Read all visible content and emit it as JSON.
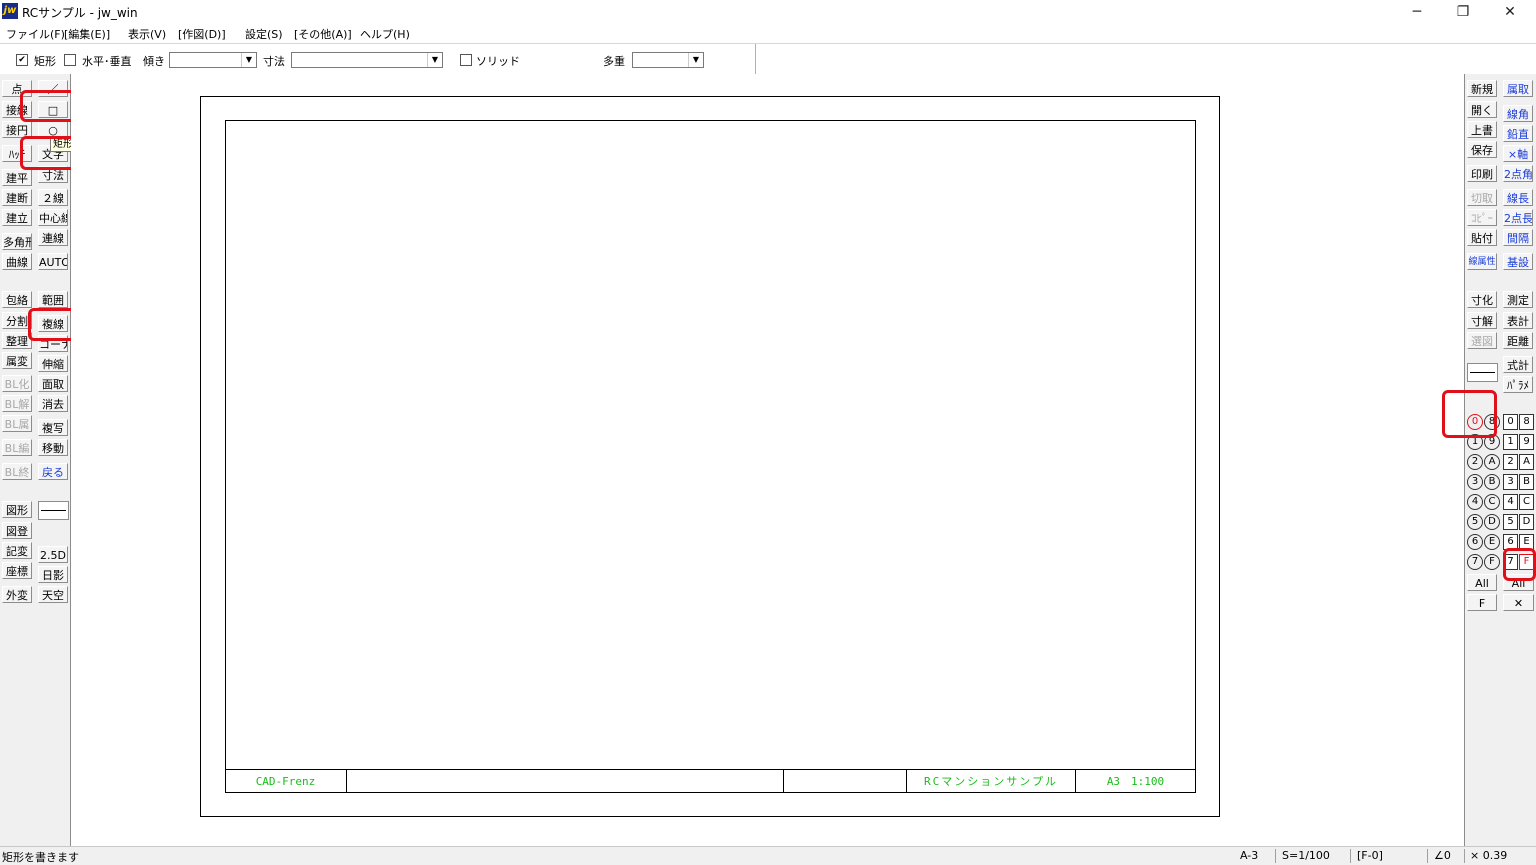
{
  "window": {
    "title": "RCサンプル - jw_win",
    "icon_text": "jw",
    "minimize": "─",
    "restore": "❐",
    "close": "✕"
  },
  "menu": [
    "ファイル(F)",
    "[編集(E)]",
    "表示(V)",
    "[作図(D)]",
    "設定(S)",
    "[その他(A)]",
    "ヘルプ(H)"
  ],
  "options": {
    "rect_check": "✔",
    "rect_label": "矩形",
    "hv_label": "水平･垂直",
    "tilt_label": "傾き",
    "dim_label": "寸法",
    "solid_label": "ソリッド",
    "multi_label": "多重"
  },
  "left_toolbar": {
    "col1": [
      "点",
      "接線",
      "接円",
      "ﾊｯﾁ",
      "建平",
      "建断",
      "建立",
      "多角形",
      "曲線",
      "包絡",
      "分割",
      "整理",
      "属変",
      "BL化",
      "BL解",
      "BL属",
      "BL編",
      "BL終",
      "図形",
      "図登",
      "記変",
      "座標",
      "外変"
    ],
    "col2": [
      "／",
      "□",
      "○",
      "文字",
      "寸法",
      "２線",
      "中心線",
      "連線",
      "AUTO",
      "範囲",
      "複線",
      "コーナー",
      "伸縮",
      "面取",
      "消去",
      "複写",
      "移動",
      "戻る",
      "2.5D",
      "日影",
      "天空"
    ]
  },
  "tooltip": "矩形",
  "title_block": {
    "company": "CAD-Frenz",
    "project": "RCマンションサンプル",
    "scale": "A3　1:100"
  },
  "right_toolbar": {
    "col1": [
      "新規",
      "開く",
      "上書",
      "保存",
      "印刷",
      "切取",
      "ｺﾋﾟｰ",
      "貼付",
      "線属性",
      "寸化",
      "寸解",
      "選図"
    ],
    "col2": [
      "属取",
      "線角",
      "鉛直",
      "×軸",
      "2点角",
      "線長",
      "2点長",
      "間隔",
      "基設",
      "測定",
      "表計",
      "距離",
      "式計",
      "ﾊﾟﾗﾒ"
    ],
    "layer_groups_circled": [
      "0",
      "1",
      "2",
      "3",
      "4",
      "5",
      "6",
      "7"
    ],
    "layer_groups_letter": [
      "8",
      "9",
      "A",
      "B",
      "C",
      "D",
      "E",
      "F"
    ],
    "layers_num": [
      "0",
      "1",
      "2",
      "3",
      "4",
      "5",
      "6",
      "7"
    ],
    "layers_alpha": [
      "8",
      "9",
      "A",
      "B",
      "C",
      "D",
      "E",
      "F"
    ],
    "all_label": "All",
    "f_label": "F",
    "all_label2": "All",
    "x_label": "✕"
  },
  "status": {
    "message": "矩形を書きます",
    "paper": "A-3",
    "scale": "S=1/100",
    "layer": "[F-0]",
    "angle": "∠0",
    "factor": "× 0.39"
  }
}
